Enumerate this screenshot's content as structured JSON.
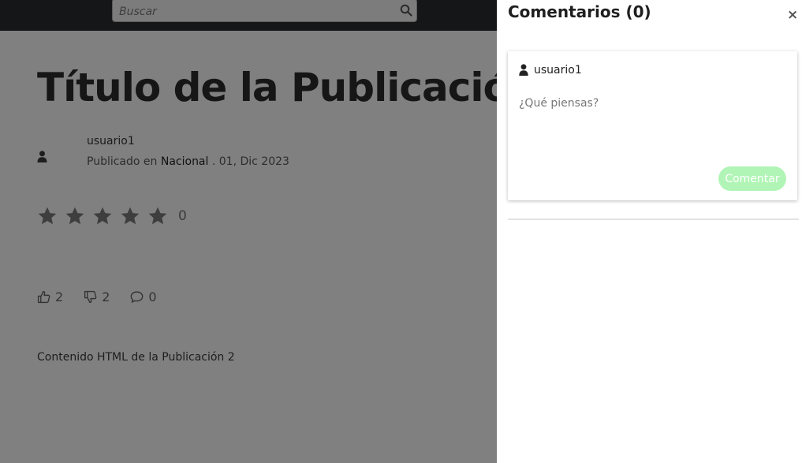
{
  "header": {
    "search": {
      "placeholder": "Buscar",
      "value": ""
    }
  },
  "post": {
    "title": "Título de la Publicación",
    "author": "usuario1",
    "published_prefix": "Publicado en",
    "category": "Nacional",
    "date_text": ". 01, Dic 2023",
    "rating": {
      "stars_total": 5,
      "stars_filled": 0,
      "count": "0"
    },
    "likes": "2",
    "dislikes": "2",
    "comments_count": "0",
    "content": "Contenido HTML de la Publicación 2"
  },
  "comments_panel": {
    "title": "Comentarios (0)",
    "close_label": "×",
    "username": "usuario1",
    "textarea_placeholder": "¿Qué piensas?",
    "submit_label": "Comentar",
    "submit_color": "#b1f5b6"
  }
}
